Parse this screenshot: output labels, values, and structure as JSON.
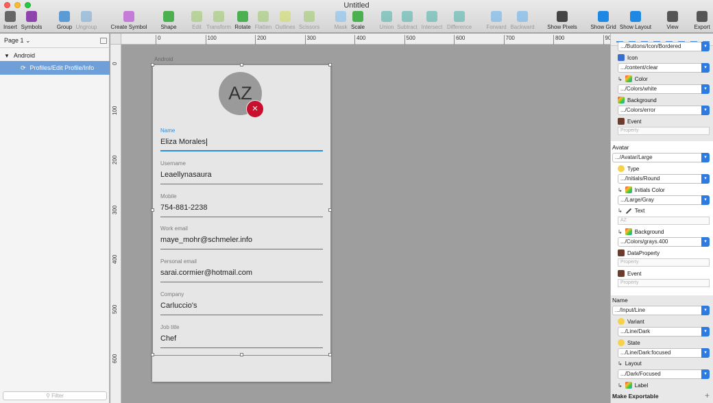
{
  "window": {
    "title": "Untitled"
  },
  "toolbar": {
    "tools": [
      {
        "id": "insert",
        "label": "Insert",
        "icon": "plus-icon",
        "enabled": true,
        "color": "#666666"
      },
      {
        "id": "symbols",
        "label": "Symbols",
        "icon": "symbols-icon",
        "enabled": true,
        "color": "#8e44ad"
      },
      {
        "id": "group",
        "label": "Group",
        "icon": "group-icon",
        "enabled": true,
        "color": "#5b9bd5"
      },
      {
        "id": "ungroup",
        "label": "Ungroup",
        "icon": "ungroup-icon",
        "enabled": false,
        "color": "#5b9bd5"
      },
      {
        "id": "create-symbol",
        "label": "Create Symbol",
        "icon": "create-symbol-icon",
        "enabled": true,
        "color": "#c57bd8"
      },
      {
        "id": "shape",
        "label": "Shape",
        "icon": "shape-icon",
        "enabled": true,
        "color": "#4caf50"
      },
      {
        "id": "edit",
        "label": "Edit",
        "icon": "edit-icon",
        "enabled": false,
        "color": "#8bc34a"
      },
      {
        "id": "transform",
        "label": "Transform",
        "icon": "transform-icon",
        "enabled": false,
        "color": "#8bc34a"
      },
      {
        "id": "rotate",
        "label": "Rotate",
        "icon": "rotate-icon",
        "enabled": true,
        "color": "#4caf50"
      },
      {
        "id": "flatten",
        "label": "Flatten",
        "icon": "flatten-icon",
        "enabled": false,
        "color": "#8bc34a"
      },
      {
        "id": "outlines",
        "label": "Outlines",
        "icon": "outlines-icon",
        "enabled": false,
        "color": "#cddc39"
      },
      {
        "id": "scissors",
        "label": "Scissors",
        "icon": "scissors-icon",
        "enabled": false,
        "color": "#8bc34a"
      },
      {
        "id": "mask",
        "label": "Mask",
        "icon": "mask-icon",
        "enabled": false,
        "color": "#64b5f6"
      },
      {
        "id": "scale",
        "label": "Scale",
        "icon": "scale-icon",
        "enabled": true,
        "color": "#4caf50"
      },
      {
        "id": "union",
        "label": "Union",
        "icon": "union-icon",
        "enabled": false,
        "color": "#26a69a"
      },
      {
        "id": "subtract",
        "label": "Subtract",
        "icon": "subtract-icon",
        "enabled": false,
        "color": "#26a69a"
      },
      {
        "id": "intersect",
        "label": "Intersect",
        "icon": "intersect-icon",
        "enabled": false,
        "color": "#26a69a"
      },
      {
        "id": "difference",
        "label": "Difference",
        "icon": "difference-icon",
        "enabled": false,
        "color": "#26a69a"
      },
      {
        "id": "forward",
        "label": "Forward",
        "icon": "forward-icon",
        "enabled": false,
        "color": "#42a5f5"
      },
      {
        "id": "backward",
        "label": "Backward",
        "icon": "backward-icon",
        "enabled": false,
        "color": "#42a5f5"
      },
      {
        "id": "show-pixels",
        "label": "Show Pixels",
        "icon": "pixels-icon",
        "enabled": true,
        "color": "#444444"
      },
      {
        "id": "show-grid",
        "label": "Show Grid",
        "icon": "grid-icon",
        "enabled": true,
        "color": "#1e88e5"
      },
      {
        "id": "show-layout",
        "label": "Show Layout",
        "icon": "layout-icon",
        "enabled": true,
        "color": "#1e88e5"
      },
      {
        "id": "view",
        "label": "View",
        "icon": "view-icon",
        "enabled": true,
        "color": "#555555"
      },
      {
        "id": "export",
        "label": "Export",
        "icon": "export-icon",
        "enabled": true,
        "color": "#555555"
      }
    ]
  },
  "sidebar": {
    "page_select": "Page 1 ⌄",
    "artboard_name": "Android",
    "symbol_name": "Profiles/Edit Profile/Info",
    "filter_placeholder": "Filter"
  },
  "rulers": {
    "top": [
      "0",
      "100",
      "200",
      "300",
      "400",
      "500",
      "600",
      "700",
      "800",
      "90"
    ],
    "left": [
      "0",
      "100",
      "200",
      "300",
      "400",
      "500",
      "600"
    ]
  },
  "artboard": {
    "label": "Android",
    "avatar_initials": "AZ",
    "badge_glyph": "×",
    "fields": [
      {
        "label": "Name",
        "value": "Eliza Morales",
        "focused": true
      },
      {
        "label": "Username",
        "value": "Leaellynasaura",
        "focused": false
      },
      {
        "label": "Mobile",
        "value": "754-881-2238",
        "focused": false
      },
      {
        "label": "Work email",
        "value": "maye_mohr@schmeler.info",
        "focused": false
      },
      {
        "label": "Personal email",
        "value": "sarai.cormier@hotmail.com",
        "focused": false
      },
      {
        "label": "Company",
        "value": "Carluccio's",
        "focused": false
      },
      {
        "label": "Job title",
        "value": "Chef",
        "focused": false
      }
    ]
  },
  "inspector": {
    "top_partial": ".../Buttons/Icon/Bordered",
    "icon": {
      "label": "Icon",
      "value": ".../content/clear"
    },
    "icon_color": {
      "label": "Color",
      "value": ".../Colors/white"
    },
    "icon_background": {
      "label": "Background",
      "value": ".../Colors/error"
    },
    "icon_event": {
      "label": "Event",
      "placeholder": "Property"
    },
    "avatar": {
      "title": "Avatar",
      "value": ".../Avatar/Large",
      "type": {
        "label": "Type",
        "value": ".../Initials/Round"
      },
      "initials_color": {
        "label": "Initials Color",
        "value": ".../Large/Gray"
      },
      "text": {
        "label": "Text",
        "placeholder": "AZ"
      },
      "background": {
        "label": "Background",
        "value": ".../Colors/grays.400"
      },
      "data_property": {
        "label": "DataProperty",
        "placeholder": "Property"
      },
      "event": {
        "label": "Event",
        "placeholder": "Property"
      }
    },
    "name": {
      "title": "Name",
      "value": ".../Input/Line",
      "variant": {
        "label": "Variant",
        "value": ".../Line/Dark"
      },
      "state": {
        "label": "State",
        "value": ".../Line/Dark:focused"
      },
      "layout": {
        "label": "Layout",
        "value": ".../Dark/Focused"
      },
      "label": {
        "label": "Label"
      }
    },
    "make_exportable": "Make Exportable"
  }
}
